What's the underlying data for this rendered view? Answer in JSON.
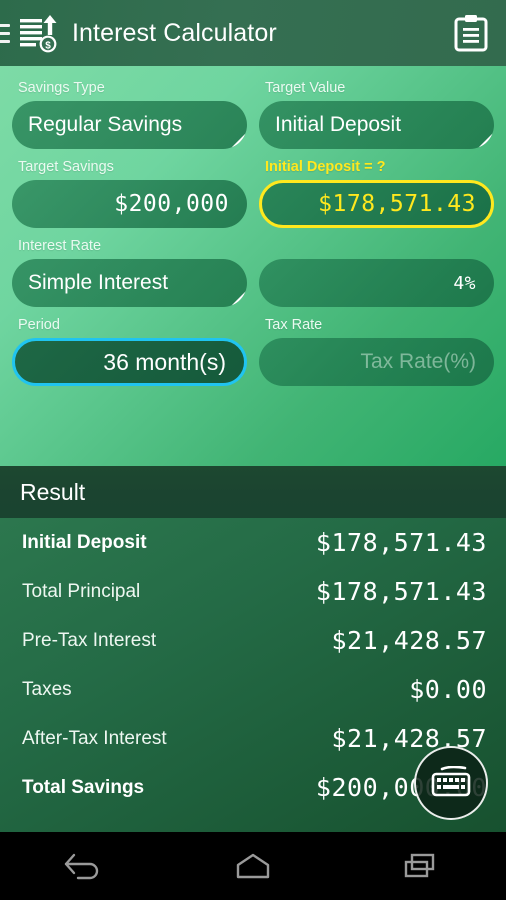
{
  "header": {
    "menu_icon": "hamburger-icon",
    "logo_icon": "interest-calculator-logo",
    "title": "Interest Calculator",
    "action_icon": "clipboard-icon"
  },
  "form": {
    "savings_type": {
      "label": "Savings Type",
      "value": "Regular Savings"
    },
    "target_value": {
      "label": "Target Value",
      "value": "Initial Deposit"
    },
    "target_savings": {
      "label": "Target Savings",
      "value": "$200,000"
    },
    "initial_deposit": {
      "label": "Initial Deposit = ?",
      "value": "$178,571.43"
    },
    "interest_rate": {
      "label": "Interest Rate",
      "value": "Simple Interest"
    },
    "rate_percent": {
      "value": "4%"
    },
    "period": {
      "label": "Period",
      "value": "36 month(s)"
    },
    "tax_rate": {
      "label": "Tax Rate",
      "placeholder": "Tax Rate(%)"
    }
  },
  "result": {
    "title": "Result",
    "rows": [
      {
        "name": "Initial Deposit",
        "value": "$178,571.43"
      },
      {
        "name": "Total Principal",
        "value": "$178,571.43"
      },
      {
        "name": "Pre-Tax Interest",
        "value": "$21,428.57"
      },
      {
        "name": "Taxes",
        "value": "$0.00"
      },
      {
        "name": "After-Tax Interest",
        "value": "$21,428.57"
      },
      {
        "name": "Total Savings",
        "value": "$200,000.00"
      }
    ]
  },
  "fab": {
    "icon": "keyboard-icon"
  },
  "navbar": {
    "back": "back-icon",
    "home": "home-icon",
    "recents": "recents-icon"
  },
  "colors": {
    "accent_yellow": "#ffe81e",
    "accent_cyan": "#20c4f0",
    "bg_light_green": "#7ddba6",
    "bg_deep_green": "#27a963",
    "result_dark": "#1a4430"
  }
}
